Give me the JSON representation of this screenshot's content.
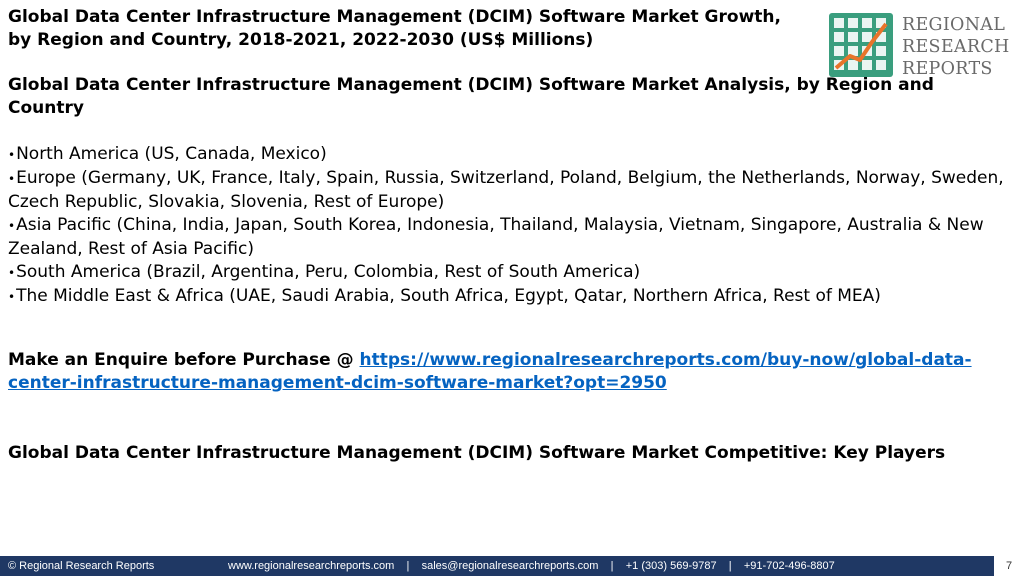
{
  "title": "Global Data Center Infrastructure Management (DCIM) Software Market Growth, by Region and Country, 2018-2021, 2022-2030 (US$ Millions)",
  "logo": {
    "line1": "REGIONAL",
    "line2": "RESEARCH",
    "line3": "REPORTS"
  },
  "analysis_heading": "Global Data Center Infrastructure Management (DCIM) Software Market Analysis, by Region and Country",
  "regions": [
    "North America (US, Canada, Mexico)",
    "Europe (Germany, UK, France, Italy, Spain, Russia, Switzerland, Poland, Belgium, the Netherlands, Norway, Sweden, Czech Republic, Slovakia, Slovenia, Rest of Europe)",
    "Asia Pacific (China, India, Japan, South Korea, Indonesia, Thailand, Malaysia, Vietnam, Singapore, Australia & New Zealand, Rest of Asia Pacific)",
    "South America (Brazil, Argentina, Peru, Colombia, Rest of South America)",
    "The Middle East & Africa (UAE, Saudi Arabia, South Africa, Egypt, Qatar, Northern Africa, Rest of MEA)"
  ],
  "bullet_char": "•",
  "enquire": {
    "prefix": "Make an Enquire before Purchase @ ",
    "link": "https://www.regionalresearchreports.com/buy-now/global-data-center-infrastructure-management-dcim-software-market?opt=2950"
  },
  "competitive_heading": "Global Data Center Infrastructure Management (DCIM) Software Market Competitive: Key Players",
  "footer": {
    "copyright": "© Regional Research Reports",
    "contacts": "www.regionalresearchreports.com    |    sales@regionalresearchreports.com    |    +1 (303) 569-9787    |    +91-702-496-8807",
    "page_number": "7"
  },
  "colors": {
    "link": "#0563c1",
    "footer_bg": "#1f3864",
    "logo_green": "#3a9e7e",
    "logo_orange": "#e8742a"
  },
  "icons": {
    "logo_mark": "chart-grid-logo-icon"
  }
}
